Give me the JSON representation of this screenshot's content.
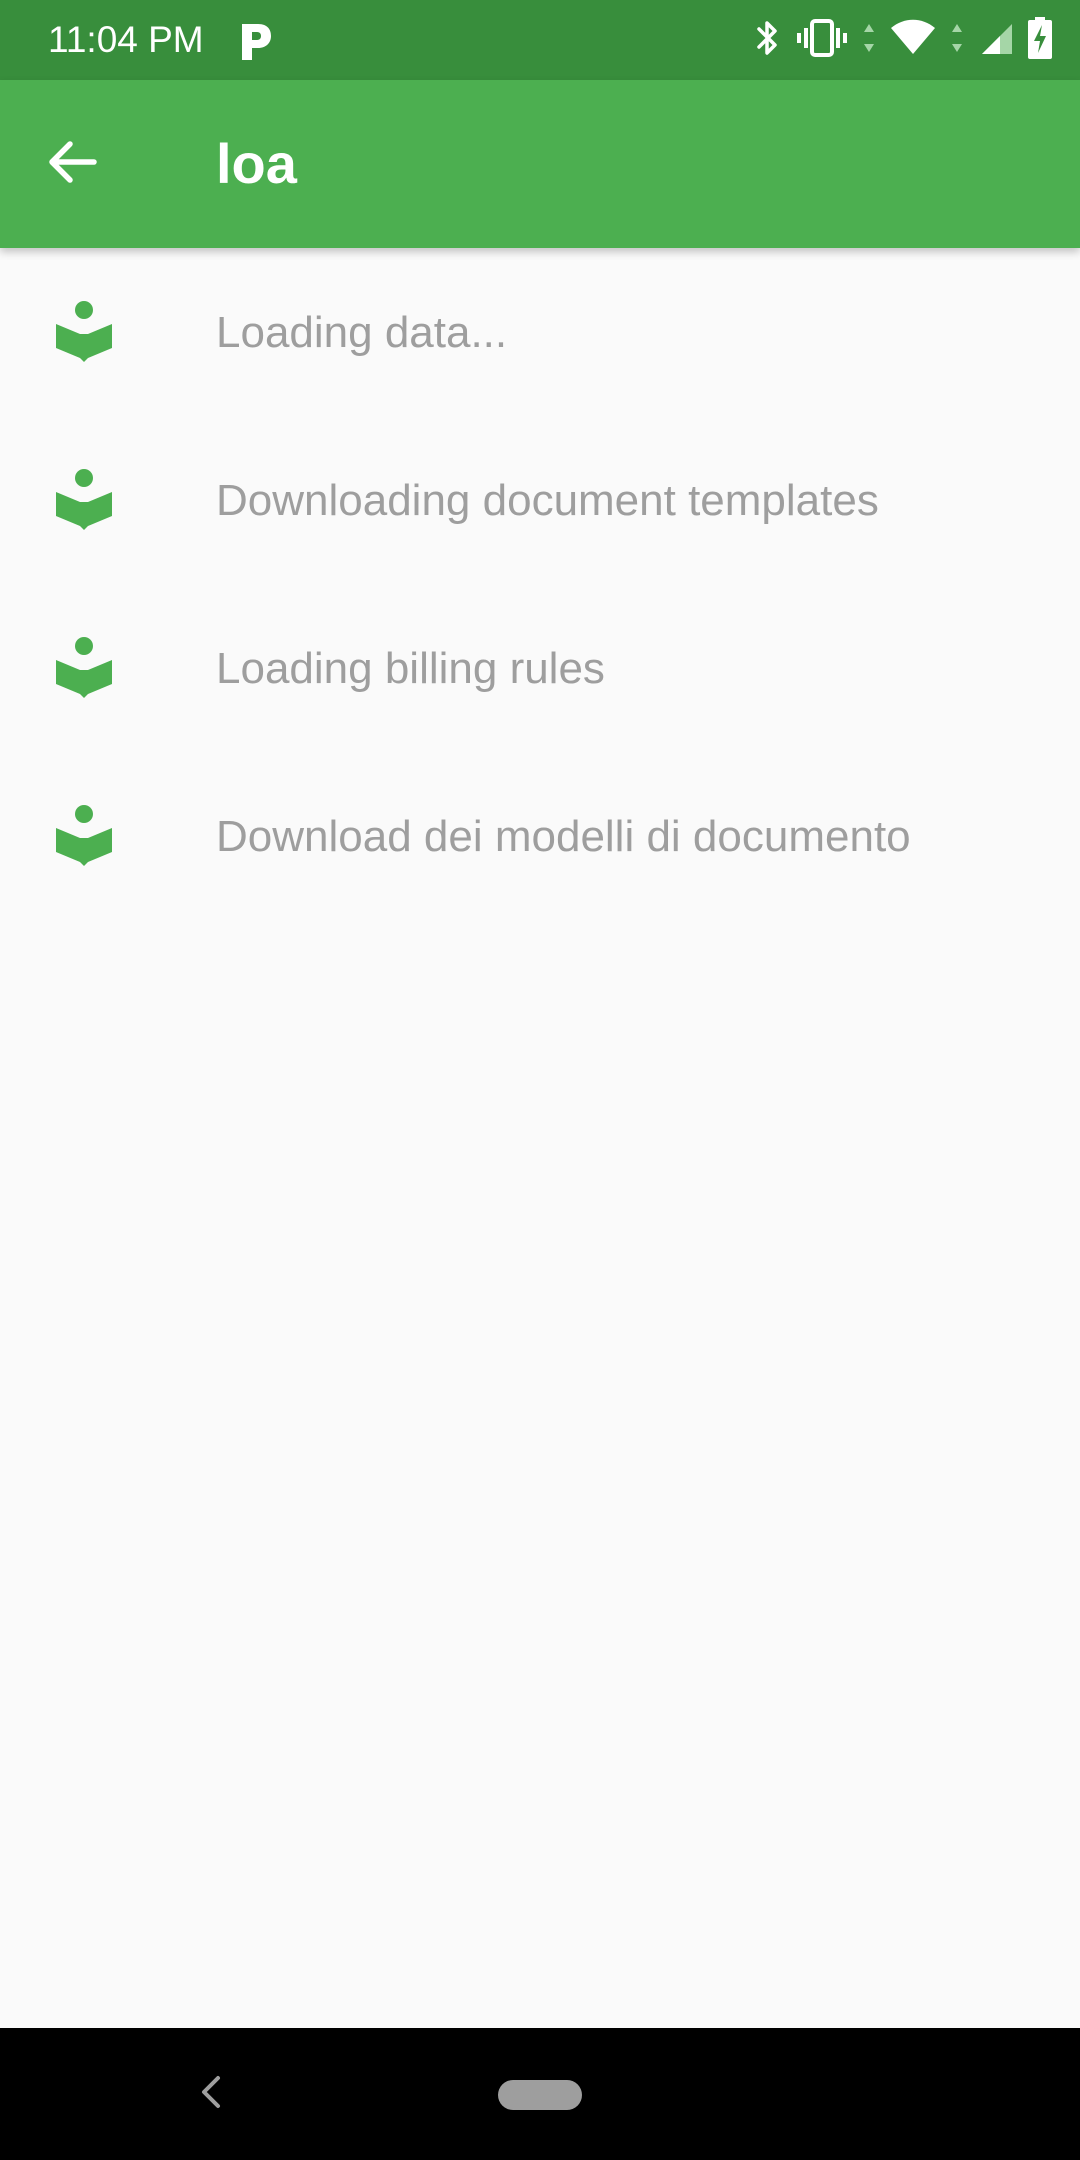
{
  "status_bar": {
    "time": "11:04 PM",
    "app_icon": "p-icon",
    "icons": [
      "bluetooth-icon",
      "vibrate-icon",
      "wifi-icon",
      "cell-signal-icon",
      "battery-charging-icon"
    ]
  },
  "app_bar": {
    "title": "loa",
    "back_icon": "arrow-back-icon",
    "background_color": "#4caf50",
    "status_bar_color": "#388e3c"
  },
  "steps": {
    "items": [
      {
        "label": "Loading data...",
        "icon": "book-reader-icon"
      },
      {
        "label": "Downloading document templates",
        "icon": "book-reader-icon"
      },
      {
        "label": "Loading billing rules",
        "icon": "book-reader-icon"
      },
      {
        "label": "Download dei modelli di documento",
        "icon": "book-reader-icon"
      }
    ],
    "icon_color": "#4caf50",
    "text_color": "#9e9e9e"
  },
  "nav_bar": {
    "back_icon": "nav-back-chevron-icon",
    "home_icon": "home-pill-icon"
  }
}
